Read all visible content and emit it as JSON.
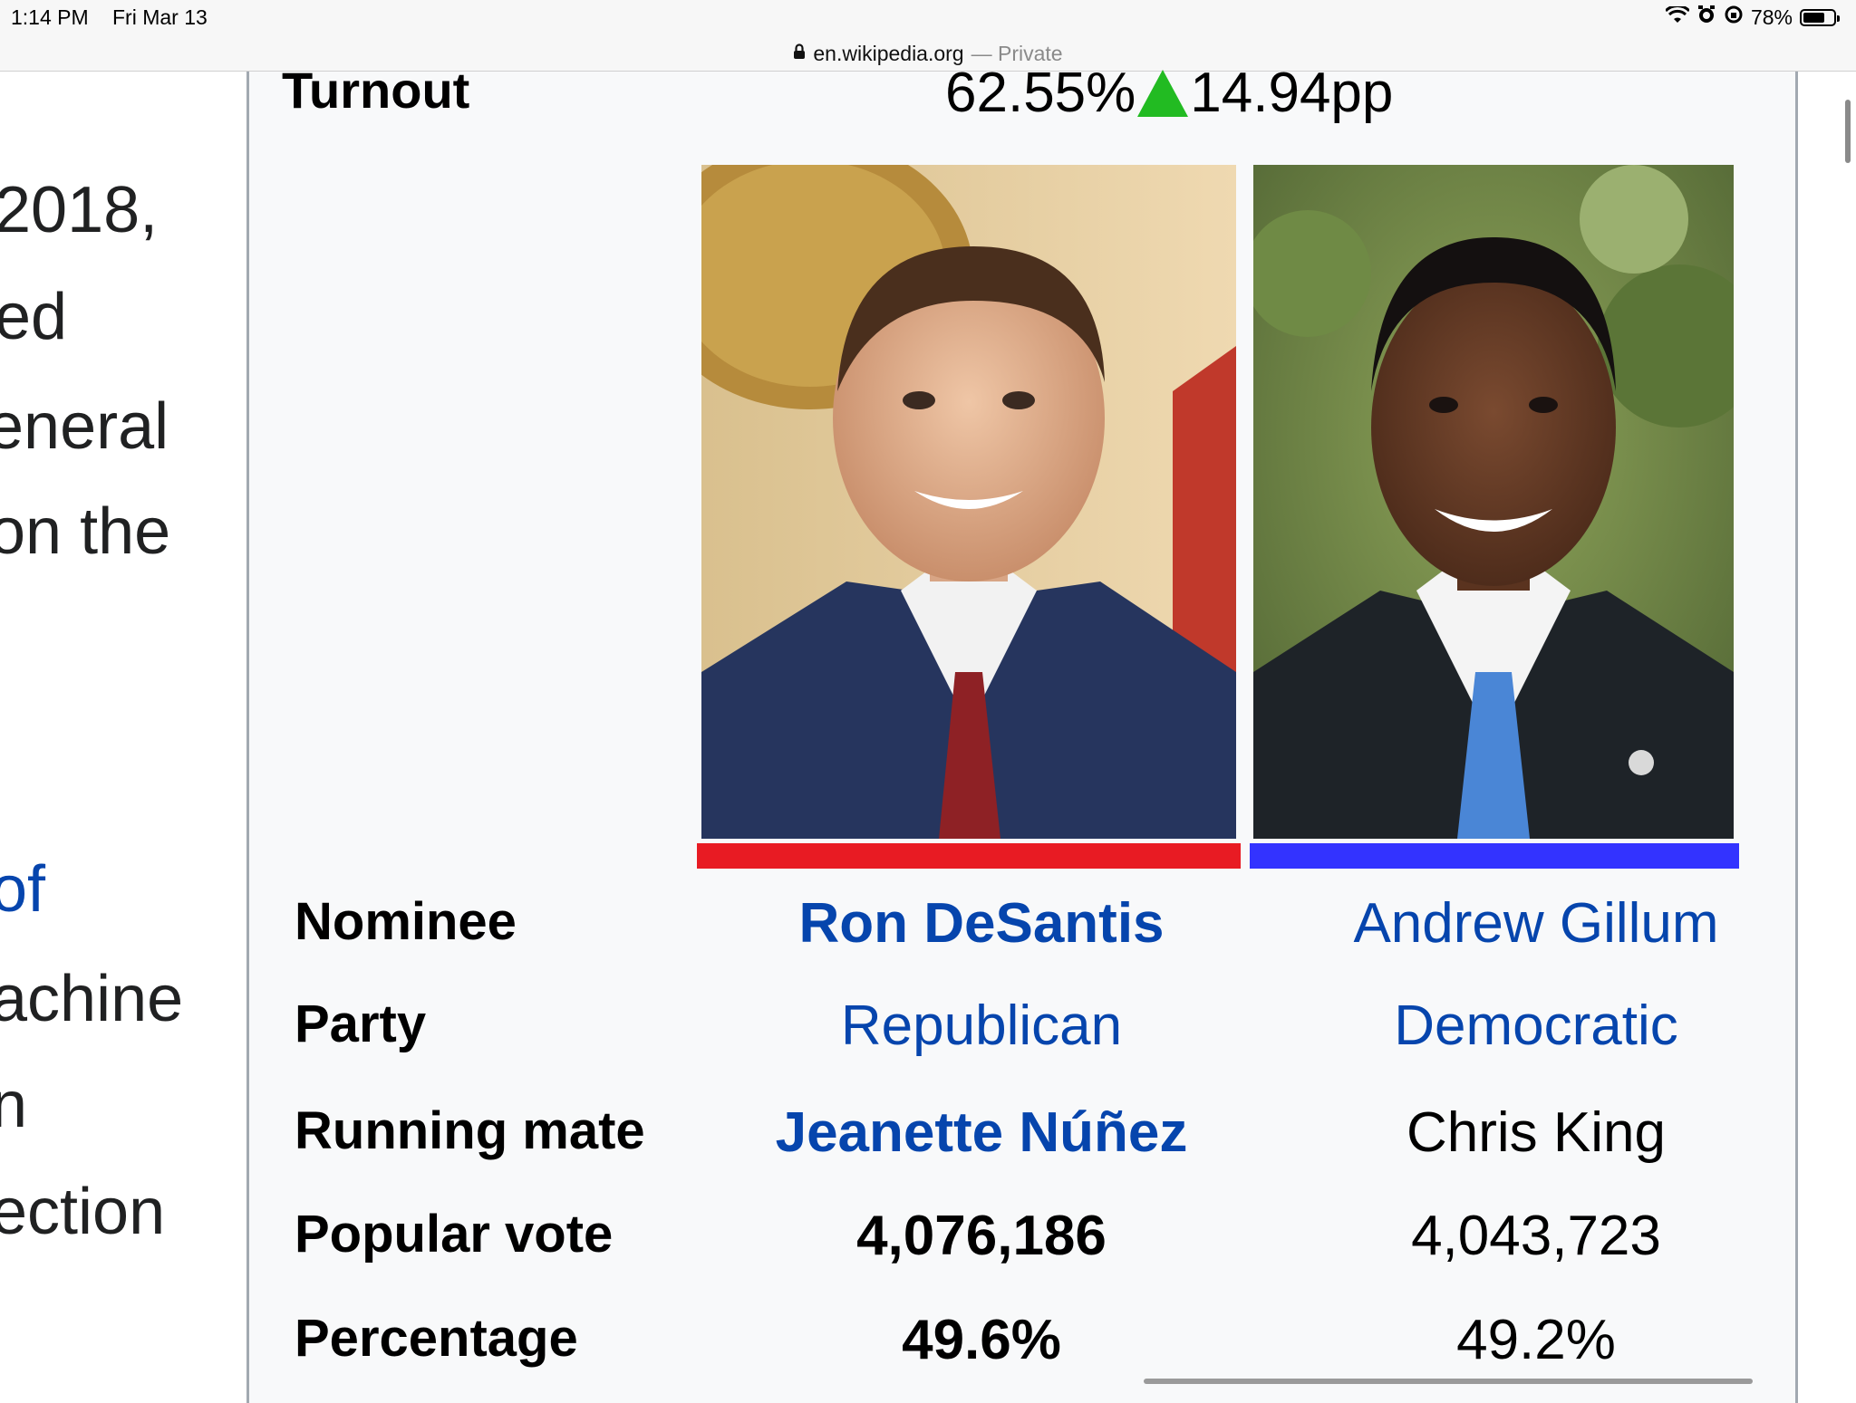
{
  "status_bar": {
    "time": "1:14 PM",
    "date": "Fri Mar 13",
    "battery_percent": "78%",
    "battery_level": 0.78,
    "icons": [
      "wifi-icon",
      "alarm-icon",
      "rotation-lock-icon"
    ]
  },
  "url_bar": {
    "domain": "en.wikipedia.org",
    "mode": "— Private",
    "icon": "lock-icon"
  },
  "article": {
    "lines": [
      "2018,",
      "ed",
      "eneral",
      "on the",
      "of",
      "achine",
      "n",
      "ection"
    ]
  },
  "infobox": {
    "turnout": {
      "label": "Turnout",
      "value": "62.55%",
      "change": "14.94pp",
      "change_icon": "up-arrow-icon"
    },
    "candidates": [
      {
        "party_color": "#e81b23",
        "nominee": "Ron DeSantis",
        "party": "Republican",
        "running_mate": "Jeanette Núñez",
        "popular_vote": "4,076,186",
        "percentage": "49.6%"
      },
      {
        "party_color": "#3333ff",
        "nominee": "Andrew Gillum",
        "party": "Democratic",
        "running_mate": "Chris King",
        "popular_vote": "4,043,723",
        "percentage": "49.2%"
      }
    ],
    "row_labels": {
      "nominee": "Nominee",
      "party": "Party",
      "running_mate": "Running mate",
      "popular_vote": "Popular vote",
      "percentage": "Percentage"
    }
  }
}
